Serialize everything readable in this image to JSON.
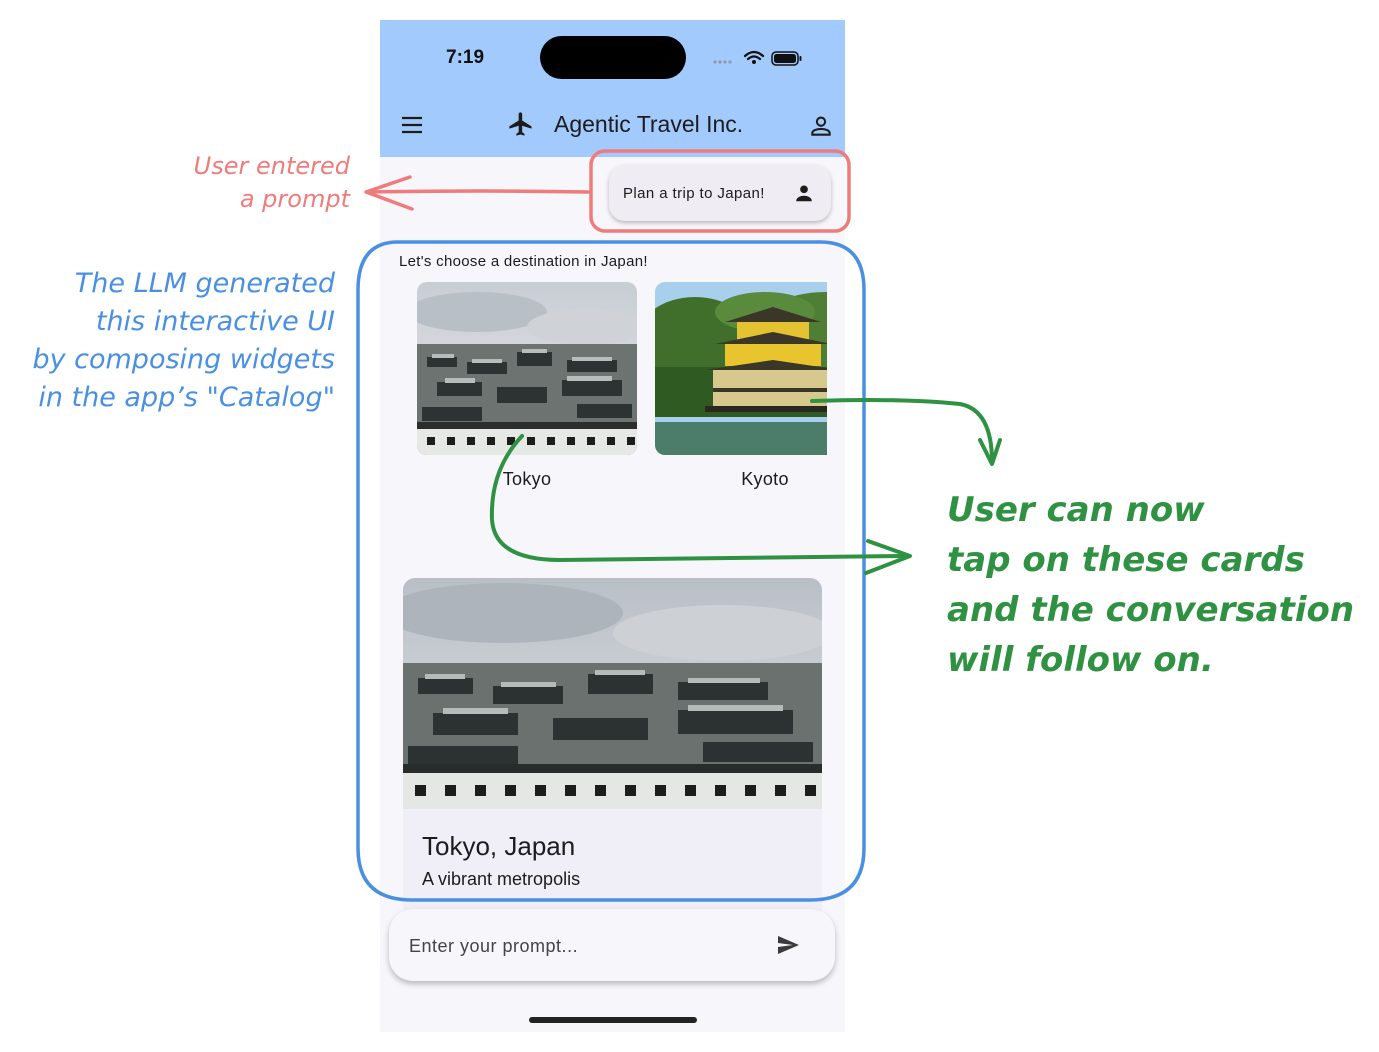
{
  "status_bar": {
    "time": "7:19"
  },
  "app_bar": {
    "title": "Agentic Travel Inc."
  },
  "user_prompt": {
    "text": "Plan a trip to Japan!"
  },
  "ai_response": {
    "intro": "Let's choose a destination in Japan!",
    "destinations": [
      {
        "label": "Tokyo"
      },
      {
        "label": "Kyoto"
      }
    ],
    "detail_card": {
      "title": "Tokyo, Japan",
      "subtitle": "A vibrant metropolis"
    }
  },
  "prompt_input": {
    "placeholder": "Enter your prompt..."
  },
  "annotations": {
    "red": [
      "User entered",
      "a prompt"
    ],
    "blue": [
      "The LLM generated",
      "this interactive UI",
      "by composing widgets",
      "in the app’s \"Catalog\""
    ],
    "green": [
      "User can now",
      "tap on these cards",
      "and the conversation",
      "will follow on."
    ]
  },
  "colors": {
    "app_bar": "#a3cafd",
    "annotation_red": "#ef7b7b",
    "annotation_blue": "#4a90e2",
    "annotation_green": "#2f9142"
  }
}
